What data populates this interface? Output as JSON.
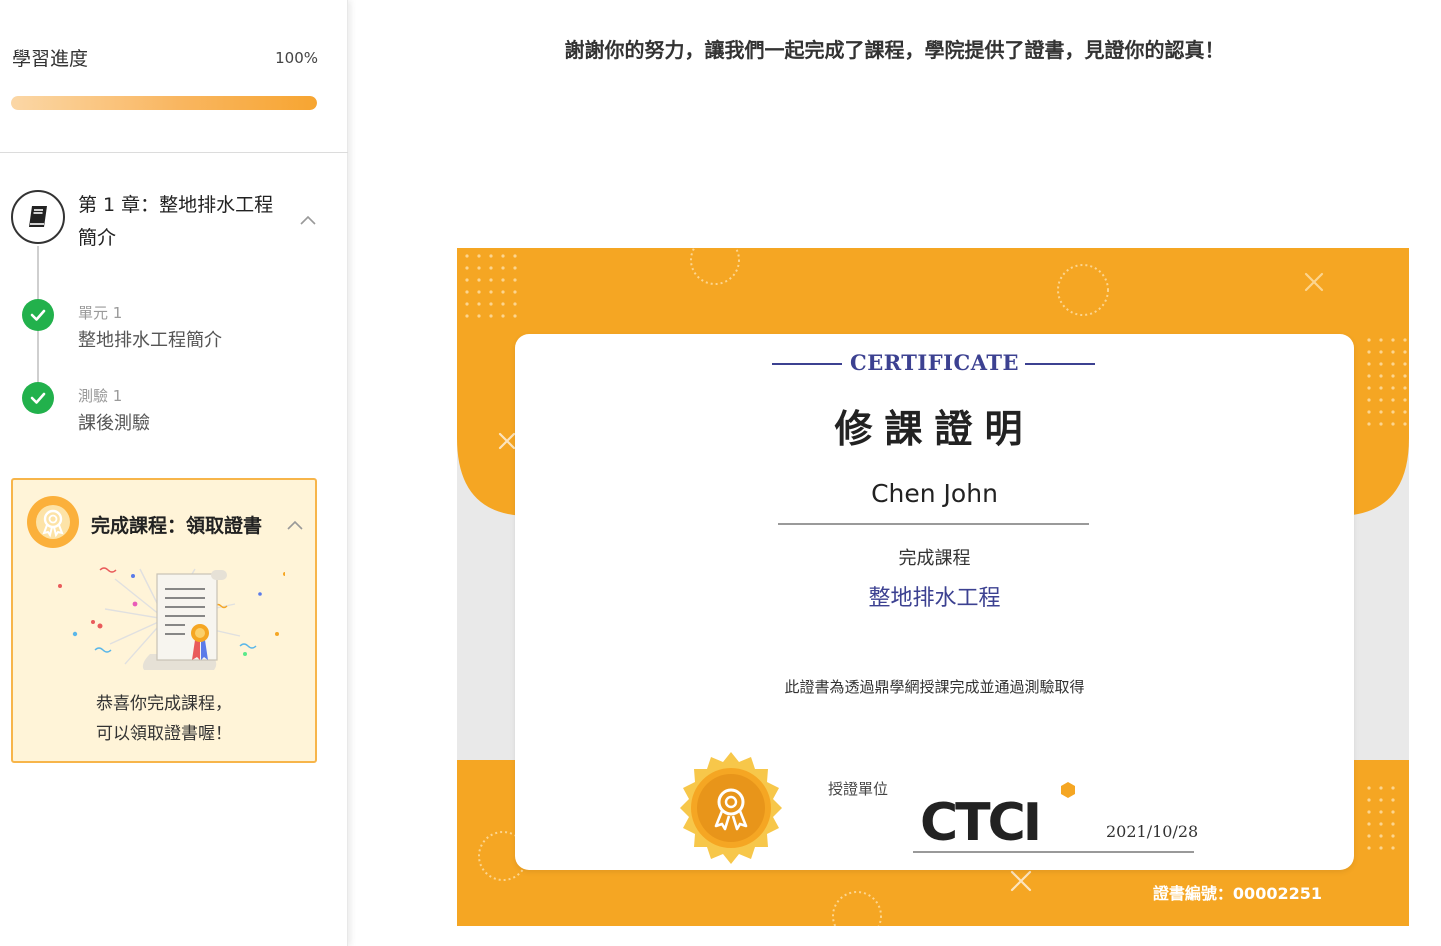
{
  "sidebar": {
    "progress": {
      "label": "學習進度",
      "percent_text": "100%",
      "value": 1.0
    },
    "chapter": {
      "icon": "book-icon",
      "title": "第 1 章：整地排水工程簡介",
      "units": [
        {
          "type": "單元 1",
          "title": "整地排水工程簡介",
          "status": "completed"
        },
        {
          "type": "測驗 1",
          "title": "課後測驗",
          "status": "completed"
        }
      ]
    },
    "finish": {
      "icon": "award-icon",
      "title": "完成課程：領取證書",
      "message_line1": "恭喜你完成課程，",
      "message_line2": "可以領取證書喔！"
    }
  },
  "main": {
    "message": "謝謝你的努力，讓我們一起完成了課程，學院提供了證書，見證你的認真！"
  },
  "certificate": {
    "heading_en": "CERTIFICATE",
    "heading_zh": "修課證明",
    "recipient": "Chen John",
    "completed_label": "完成課程",
    "course_name": "整地排水工程",
    "note": "此證書為透過鼎學網授課完成並通過測驗取得",
    "issuer_label": "授證單位",
    "issuer_logo_text": "CTCI",
    "date": "2021/10/28",
    "serial": "證書編號：00002251"
  },
  "colors": {
    "accent_orange": "#f5a623",
    "cert_blue": "#3c4191",
    "check_green": "#22b14c",
    "finish_bg": "#fff4d8"
  }
}
